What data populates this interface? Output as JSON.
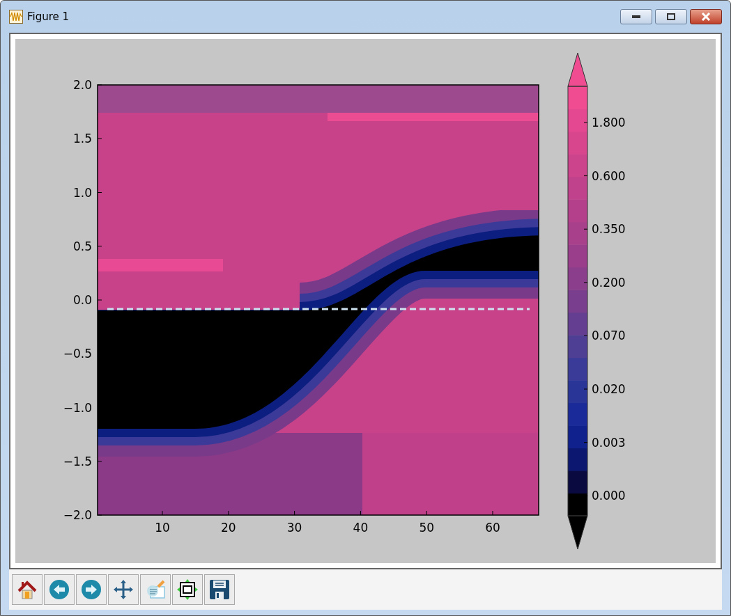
{
  "window": {
    "title": "Figure 1"
  },
  "plot": {
    "yticks": [
      "2.0",
      "1.5",
      "1.0",
      "0.5",
      "0.0",
      "−0.5",
      "−1.0",
      "−1.5",
      "−2.0"
    ],
    "xticks": [
      "10",
      "20",
      "30",
      "40",
      "50",
      "60"
    ],
    "colorbar_ticks": [
      "1.800",
      "0.600",
      "0.350",
      "0.200",
      "0.070",
      "0.020",
      "0.003",
      "0.000"
    ]
  },
  "toolbar": [
    {
      "kind": "home"
    },
    {
      "kind": "back"
    },
    {
      "kind": "forward"
    },
    {
      "kind": "pan"
    },
    {
      "kind": "subplots"
    },
    {
      "kind": "zoom"
    },
    {
      "kind": "save"
    }
  ]
}
